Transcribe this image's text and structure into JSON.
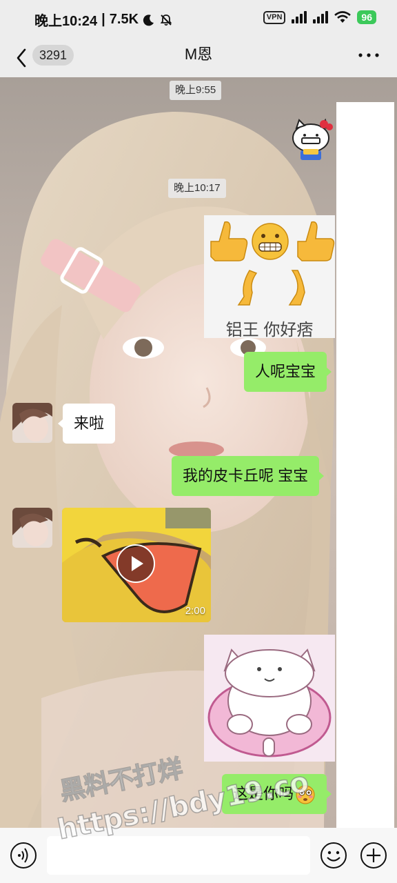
{
  "status_bar": {
    "time": "晚上10:24",
    "separator": "|",
    "net_speed": "7.5K",
    "vpn_label": "VPN",
    "battery": "96"
  },
  "nav": {
    "unread_count": "3291",
    "title": "M恩"
  },
  "messages": {
    "time_1": "晚上9:55",
    "time_2": "晚上10:17",
    "sticker_thumbs_caption": "铝王 你好痞",
    "out_1": "人呢宝宝",
    "in_1": "来啦",
    "out_2": "我的皮卡丘呢 宝宝",
    "video_duration": "2:00",
    "out_3": "这是你吗"
  },
  "watermark": {
    "line1": "黑料不打烊",
    "line2": "https://bdy19.co"
  },
  "input": {
    "placeholder": ""
  },
  "colors": {
    "outgoing_bubble": "#95ec69",
    "incoming_bubble": "#ffffff",
    "bar_background": "#ededed",
    "battery": "#3cc95a"
  },
  "icons": {
    "back": "chevron-left-icon",
    "more": "more-dots-icon",
    "voice": "voice-icon",
    "emoji": "emoji-icon",
    "plus": "plus-icon",
    "play": "play-icon"
  }
}
